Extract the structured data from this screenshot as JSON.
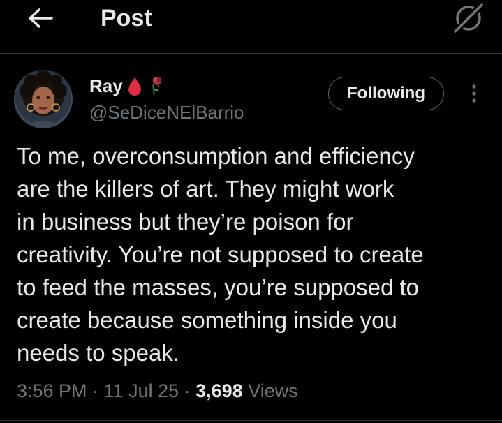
{
  "header": {
    "title": "Post",
    "back_icon": "arrow-left-icon",
    "grok_icon": "grok-icon"
  },
  "author": {
    "display_name": "Ray",
    "emojis": [
      "drop-of-blood-icon",
      "wilted-rose-icon"
    ],
    "handle": "@SeDiceNElBarrio"
  },
  "follow_button": {
    "label": "Following"
  },
  "more_icon": "more-vertical-icon",
  "tweet": {
    "lines": [
      "To me, overconsumption and efficiency",
      "are the killers of art. They might work",
      "in business but they’re poison for",
      "creativity. You’re not supposed to create",
      "to feed the masses, you’re supposed to",
      "create because something inside you",
      "needs to speak."
    ]
  },
  "meta": {
    "time": "3:56 PM",
    "sep1": " · ",
    "date": "11 Jul 25",
    "sep2": " · ",
    "views_count": "3,698",
    "views_label": " Views"
  },
  "colors": {
    "background": "#000000",
    "text_primary": "#e7e9ea",
    "text_secondary": "#71767b",
    "divider": "#2f3336",
    "drop_red": "#dd2e44"
  }
}
